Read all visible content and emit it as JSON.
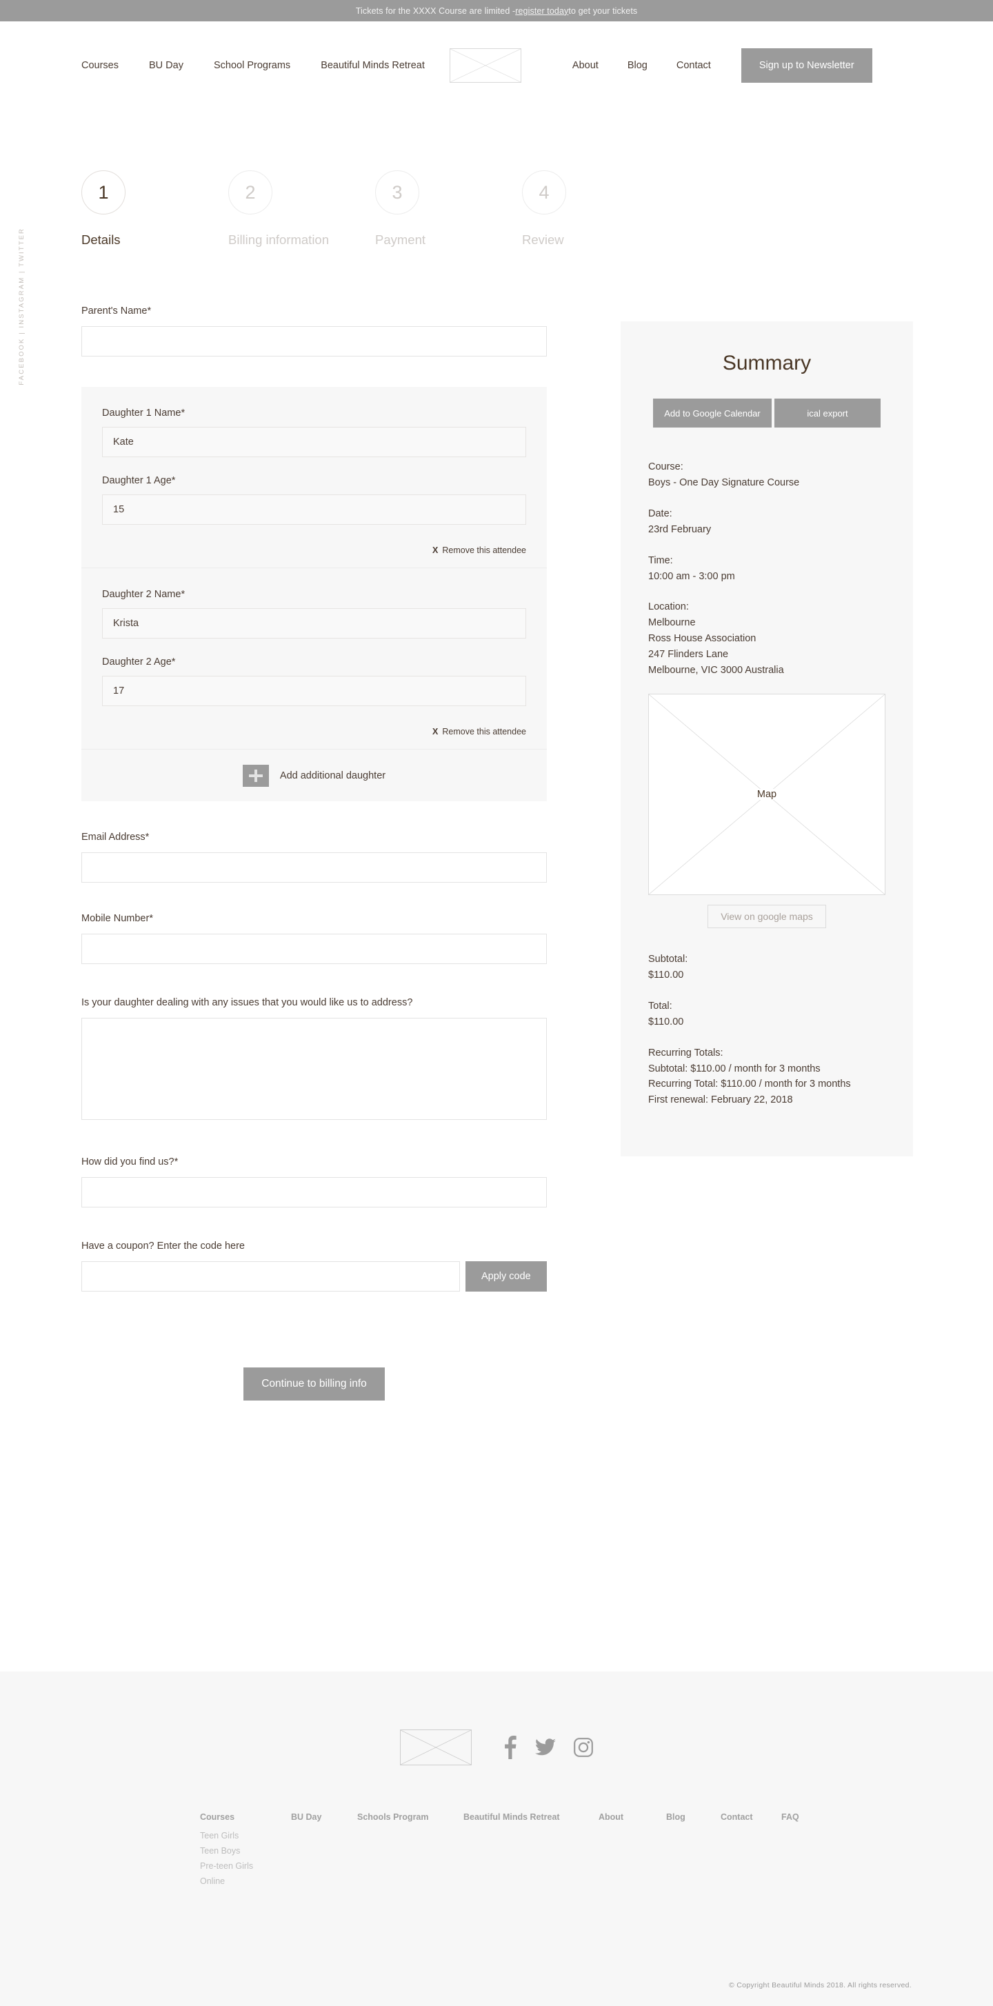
{
  "announcement": {
    "prefix": "Tickets for the XXXX Course are limited - ",
    "link": "register today",
    "suffix": " to get your tickets"
  },
  "header": {
    "nav_left": [
      {
        "label": "Courses"
      },
      {
        "label": "BU Day"
      },
      {
        "label": "School Programs"
      },
      {
        "label": "Beautiful Minds Retreat"
      }
    ],
    "logo_alt": "logo-placeholder",
    "nav_right": [
      {
        "label": "About"
      },
      {
        "label": "Blog"
      },
      {
        "label": "Contact"
      }
    ],
    "newsletter_button": "Sign up to Newsletter"
  },
  "social_rail": "FACEBOOK  |  INSTAGRAM  |  TWITTER",
  "steps": [
    {
      "number": "1",
      "label": "Details",
      "active": true
    },
    {
      "number": "2",
      "label": "Billing information",
      "active": false
    },
    {
      "number": "3",
      "label": "Payment",
      "active": false
    },
    {
      "number": "4",
      "label": "Review",
      "active": false
    }
  ],
  "form": {
    "parent_name": {
      "label": "Parent's Name*",
      "value": "",
      "placeholder": ""
    },
    "attendees": [
      {
        "name_label": "Daughter 1 Name*",
        "name_value": "Kate",
        "age_label": "Daughter 1 Age*",
        "age_value": "15",
        "remove_x": "X",
        "remove_label": "Remove this attendee"
      },
      {
        "name_label": "Daughter 2 Name*",
        "name_value": "Krista",
        "age_label": "Daughter 2 Age*",
        "age_value": "17",
        "remove_x": "X",
        "remove_label": "Remove this attendee"
      }
    ],
    "add_attendee_label": "Add additional daughter",
    "email": {
      "label": "Email Address*",
      "value": "",
      "placeholder": ""
    },
    "mobile": {
      "label": "Mobile Number*",
      "value": "",
      "placeholder": ""
    },
    "issues": {
      "label": "Is your daughter dealing with any issues that you would like us to address?",
      "value": "",
      "placeholder": ""
    },
    "find_us": {
      "label": "How did you find us?*",
      "value": "",
      "placeholder": ""
    },
    "coupon": {
      "label": "Have a coupon? Enter the code here",
      "value": "",
      "placeholder": "",
      "apply_label": "Apply code"
    },
    "continue_button": "Continue to billing info"
  },
  "summary": {
    "title": "Summary",
    "gcal_button": "Add to Google Calendar",
    "ical_button": "ical export",
    "course_key": "Course:",
    "course_value": "Boys - One Day Signature Course",
    "date_key": "Date:",
    "date_value": "23rd February",
    "time_key": "Time:",
    "time_value": "10:00 am - 3:00 pm",
    "location_key": "Location:",
    "location_line1": "Melbourne",
    "location_line2": "Ross House Association",
    "location_line3": "247 Flinders Lane",
    "location_line4": "Melbourne, VIC 3000 Australia",
    "map_label": "Map",
    "maps_button": "View on google maps",
    "subtotal_key": "Subtotal:",
    "subtotal_value": "$110.00",
    "total_key": "Total:",
    "total_value": "$110.00",
    "recurring_key": "Recurring Totals:",
    "recurring_subtotal": "Subtotal: $110.00 / month for 3 months",
    "recurring_total": "Recurring Total: $110.00 / month for 3 months",
    "first_renewal": "First renewal: February 22, 2018"
  },
  "footer": {
    "logo_alt": "footer-logo-placeholder",
    "social": [
      {
        "name": "facebook-icon"
      },
      {
        "name": "twitter-icon"
      },
      {
        "name": "instagram-icon"
      }
    ],
    "columns": [
      {
        "head": "Courses",
        "items": [
          "Teen Girls",
          "Teen Boys",
          "Pre-teen Girls",
          "Online"
        ]
      },
      {
        "head": "BU Day",
        "items": []
      },
      {
        "head": "Schools Program",
        "items": []
      },
      {
        "head": "Beautiful Minds Retreat",
        "items": []
      },
      {
        "head": "About",
        "items": []
      },
      {
        "head": "Blog",
        "items": []
      },
      {
        "head": "Contact",
        "items": []
      },
      {
        "head": "FAQ",
        "items": []
      }
    ],
    "copyright": "© Copyright Beautiful Minds 2018. All rights reserved."
  },
  "colors": {
    "accent_gray": "#9b9b9b",
    "panel_bg": "#f7f7f7",
    "text": "#4a3c33",
    "muted": "#cfcbc8"
  }
}
